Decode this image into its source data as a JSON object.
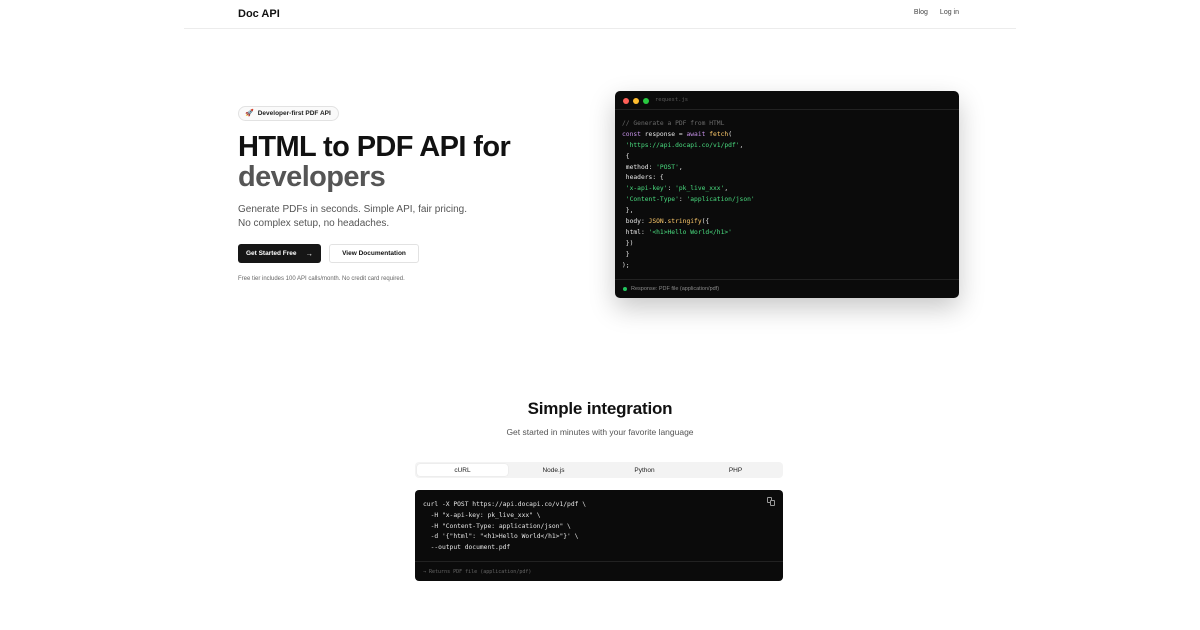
{
  "nav": {
    "brand": "Doc API",
    "links": [
      "Blog",
      "Log in"
    ]
  },
  "hero": {
    "badge_icon": "rocket-icon",
    "badge_emoji": "🚀",
    "badge": "Developer-first PDF API",
    "title_line1": "HTML to PDF API for",
    "title_line2": "developers",
    "subtitle": "Generate PDFs in seconds. Simple API, fair pricing. No complex setup, no headaches.",
    "cta_primary": "Get Started Free",
    "cta_primary_icon": "→",
    "cta_secondary": "View Documentation",
    "fine_print": "Free tier includes 100 API calls/month. No credit card required."
  },
  "code_window": {
    "filename": "request.js",
    "lines": [
      {
        "indent": "",
        "tokens": [
          {
            "t": "// Generate a PDF from HTML",
            "k": "com"
          }
        ]
      },
      {
        "indent": "",
        "tokens": [
          {
            "t": "const",
            "k": "kw"
          },
          {
            "t": " response = ",
            "k": ""
          },
          {
            "t": "await",
            "k": "kw"
          },
          {
            "t": " ",
            "k": ""
          },
          {
            "t": "fetch",
            "k": "fn"
          },
          {
            "t": "(",
            "k": ""
          }
        ]
      },
      {
        "indent": " ",
        "tokens": [
          {
            "t": "'https://api.docapi.co/v1/pdf'",
            "k": "str"
          },
          {
            "t": ",",
            "k": ""
          }
        ]
      },
      {
        "indent": " ",
        "tokens": [
          {
            "t": "{",
            "k": ""
          }
        ]
      },
      {
        "indent": " ",
        "tokens": [
          {
            "t": "method: ",
            "k": ""
          },
          {
            "t": "'POST'",
            "k": "str"
          },
          {
            "t": ",",
            "k": ""
          }
        ]
      },
      {
        "indent": " ",
        "tokens": [
          {
            "t": "headers: {",
            "k": ""
          }
        ]
      },
      {
        "indent": " ",
        "tokens": [
          {
            "t": "'x-api-key'",
            "k": "str"
          },
          {
            "t": ": ",
            "k": ""
          },
          {
            "t": "'pk_live_xxx'",
            "k": "str"
          },
          {
            "t": ",",
            "k": ""
          }
        ]
      },
      {
        "indent": " ",
        "tokens": [
          {
            "t": "'Content-Type'",
            "k": "str"
          },
          {
            "t": ": ",
            "k": ""
          },
          {
            "t": "'application/json'",
            "k": "str"
          }
        ]
      },
      {
        "indent": " ",
        "tokens": [
          {
            "t": "},",
            "k": ""
          }
        ]
      },
      {
        "indent": " ",
        "tokens": [
          {
            "t": "body: ",
            "k": ""
          },
          {
            "t": "JSON",
            "k": "fn"
          },
          {
            "t": ".",
            "k": ""
          },
          {
            "t": "stringify",
            "k": "fn"
          },
          {
            "t": "({",
            "k": ""
          }
        ]
      },
      {
        "indent": " ",
        "tokens": [
          {
            "t": "html: ",
            "k": ""
          },
          {
            "t": "'<h1>Hello World</h1>'",
            "k": "str"
          }
        ]
      },
      {
        "indent": " ",
        "tokens": [
          {
            "t": "})",
            "k": ""
          }
        ]
      },
      {
        "indent": " ",
        "tokens": [
          {
            "t": "}",
            "k": ""
          }
        ]
      },
      {
        "indent": "",
        "tokens": [
          {
            "t": ");",
            "k": ""
          }
        ]
      }
    ],
    "footer": "Response: PDF file (application/pdf)"
  },
  "integration": {
    "title": "Simple integration",
    "subtitle": "Get started in minutes with your favorite language",
    "tabs": [
      {
        "label": "cURL",
        "active": true
      },
      {
        "label": "Node.js",
        "active": false
      },
      {
        "label": "Python",
        "active": false
      },
      {
        "label": "PHP",
        "active": false
      }
    ],
    "copy_icon": "copy-icon",
    "code_lines": [
      "curl -X POST https://api.docapi.co/v1/pdf \\",
      "  -H \"x-api-key: pk_live_xxx\" \\",
      "  -H \"Content-Type: application/json\" \\",
      "  -d '{\"html\": \"<h1>Hello World</h1>\"}' \\",
      "  --output document.pdf"
    ],
    "footer": "→ Returns PDF file (application/pdf)"
  }
}
